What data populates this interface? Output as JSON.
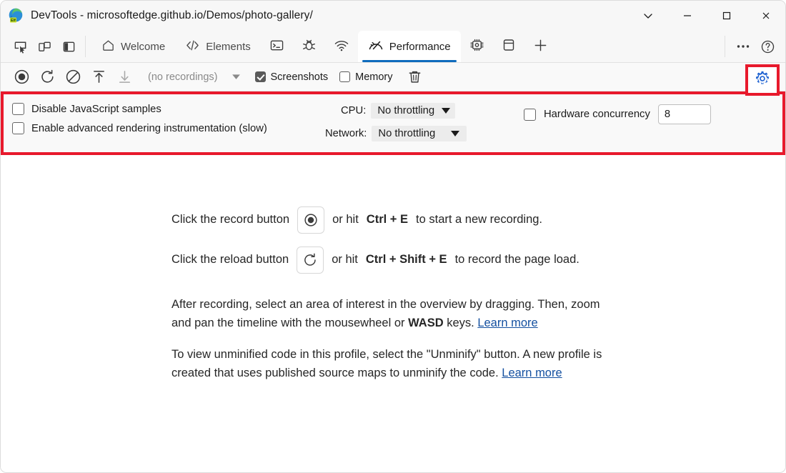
{
  "window": {
    "title": "DevTools - microsoftedge.github.io/Demos/photo-gallery/",
    "logo_icon": "edge-dev-logo-icon",
    "caption": {
      "more_icon": "chevron-down-icon",
      "minimize_icon": "minimize-icon",
      "maximize_icon": "maximize-icon",
      "close_icon": "close-icon"
    }
  },
  "tabstrip": {
    "dock_buttons": [
      {
        "icon": "inspect-element-icon",
        "name": "inspect-tool-button"
      },
      {
        "icon": "device-emulation-icon",
        "name": "device-emulation-button"
      },
      {
        "icon": "dock-side-panel-icon",
        "name": "dock-side-button"
      }
    ],
    "tabs": [
      {
        "label": "Welcome",
        "icon": "home-icon",
        "active": false
      },
      {
        "label": "Elements",
        "icon": "code-brackets-icon",
        "active": false
      },
      {
        "label": "",
        "icon": "console-icon",
        "active": false
      },
      {
        "label": "",
        "icon": "bug-sources-icon",
        "active": false
      },
      {
        "label": "",
        "icon": "network-wifi-icon",
        "active": false
      },
      {
        "label": "Performance",
        "icon": "performance-gauge-icon",
        "active": true
      },
      {
        "label": "",
        "icon": "memory-chip-icon",
        "active": false
      },
      {
        "label": "",
        "icon": "application-storage-icon",
        "active": false
      },
      {
        "label": "",
        "icon": "plus-icon",
        "active": false
      }
    ],
    "right_buttons": [
      {
        "icon": "more-options-icon",
        "name": "more-tools-button"
      },
      {
        "icon": "help-question-icon",
        "name": "help-button"
      }
    ]
  },
  "perf_toolbar": {
    "buttons": [
      {
        "icon": "record-icon",
        "name": "record-button"
      },
      {
        "icon": "reload-record-icon",
        "name": "reload-and-record-button"
      },
      {
        "icon": "clear-icon",
        "name": "clear-button"
      },
      {
        "icon": "upload-icon",
        "name": "load-profile-button"
      },
      {
        "icon": "download-icon",
        "name": "save-profile-button"
      }
    ],
    "recordings_label": "(no recordings)",
    "recordings_caret_icon": "caret-down-icon",
    "screenshots_label": "Screenshots",
    "screenshots_checked": true,
    "memory_label": "Memory",
    "memory_checked": false,
    "trash_icon": "trash-icon",
    "settings_icon": "gear-icon",
    "settings_active_color": "#1a5fd0",
    "highlight_color": "#e8192c"
  },
  "settings": {
    "disable_js_samples_label": "Disable JavaScript samples",
    "disable_js_samples_checked": false,
    "advanced_rendering_label": "Enable advanced rendering instrumentation (slow)",
    "advanced_rendering_checked": false,
    "cpu_label": "CPU:",
    "cpu_value": "No throttling",
    "network_label": "Network:",
    "network_value": "No throttling",
    "hardware_concurrency_label": "Hardware concurrency",
    "hardware_concurrency_checked": false,
    "hardware_concurrency_value": "8"
  },
  "landing": {
    "record_line": {
      "prefix": "Click the record button",
      "icon": "record-icon",
      "mid": "or hit",
      "shortcut": "Ctrl + E",
      "suffix": "to start a new recording."
    },
    "reload_line": {
      "prefix": "Click the reload button",
      "icon": "reload-icon",
      "mid": "or hit",
      "shortcut": "Ctrl + Shift + E",
      "suffix": "to record the page load."
    },
    "overview_para": {
      "part1": "After recording, select an area of interest in the overview by dragging. Then, zoom and pan the timeline with the mousewheel or",
      "bold": "WASD",
      "part2": "keys.",
      "link": "Learn more"
    },
    "unminify_para": {
      "part1": "To view unminified code in this profile, select the \"Unminify\" button. A new profile is created that uses published source maps to unminify the code.",
      "link": "Learn more"
    }
  }
}
